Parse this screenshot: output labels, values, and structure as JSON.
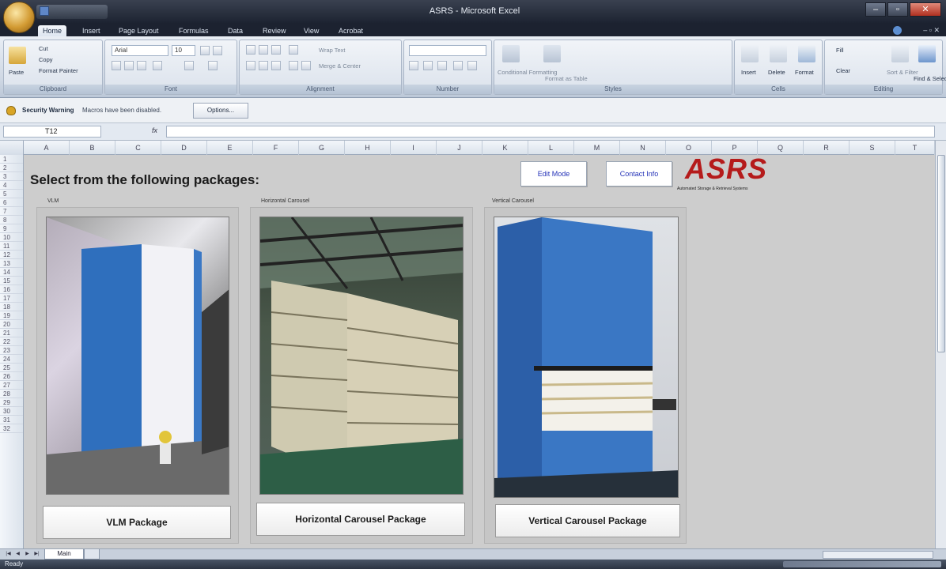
{
  "window": {
    "title": "ASRS - Microsoft Excel"
  },
  "tabs": [
    "Home",
    "Insert",
    "Page Layout",
    "Formulas",
    "Data",
    "Review",
    "View",
    "Acrobat"
  ],
  "ribbon": {
    "groups": [
      "Clipboard",
      "Font",
      "Alignment",
      "Number",
      "Styles",
      "Cells",
      "Editing"
    ],
    "clipboard": {
      "paste": "Paste",
      "cut": "Cut",
      "copy": "Copy",
      "format_painter": "Format Painter"
    },
    "font": {
      "name": "Arial",
      "size": "10"
    },
    "alignment": {
      "wrap": "Wrap Text",
      "merge": "Merge & Center"
    },
    "styles": {
      "conditional": "Conditional Formatting",
      "format_table": "Format as Table"
    },
    "cells": {
      "insert": "Insert",
      "delete": "Delete",
      "format": "Format"
    },
    "editing": {
      "fill": "Fill",
      "clear": "Clear",
      "sort": "Sort & Filter",
      "find": "Find & Select"
    }
  },
  "security": {
    "title": "Security Warning",
    "message": "Macros have been disabled.",
    "options": "Options..."
  },
  "formula_bar": {
    "name_box": "T12",
    "fx": "fx",
    "value": ""
  },
  "columns": [
    "A",
    "B",
    "C",
    "D",
    "E",
    "F",
    "G",
    "H",
    "I",
    "J",
    "K",
    "L",
    "M",
    "N",
    "O",
    "P",
    "Q",
    "R",
    "S",
    "T"
  ],
  "rows": [
    "1",
    "2",
    "3",
    "4",
    "5",
    "6",
    "7",
    "8",
    "9",
    "10",
    "11",
    "12",
    "13",
    "14",
    "15",
    "16",
    "17",
    "18",
    "19",
    "20",
    "21",
    "22",
    "23",
    "24",
    "25",
    "26",
    "27",
    "28",
    "29",
    "30",
    "31",
    "32"
  ],
  "sheet": {
    "headline": "Select from the following packages:",
    "edit_mode": "Edit Mode",
    "contact": "Contact Info",
    "logo": "ASRS",
    "logo_tagline": "Automated Storage & Retrieval Systems",
    "packages": [
      {
        "label": "VLM",
        "button": "VLM Package"
      },
      {
        "label": "Horizontal Carousel",
        "button": "Horizontal Carousel Package"
      },
      {
        "label": "Vertical Carousel",
        "button": "Vertical Carousel Package"
      }
    ]
  },
  "sheet_tabs": {
    "main": "Main"
  },
  "status": {
    "text": "Ready"
  }
}
